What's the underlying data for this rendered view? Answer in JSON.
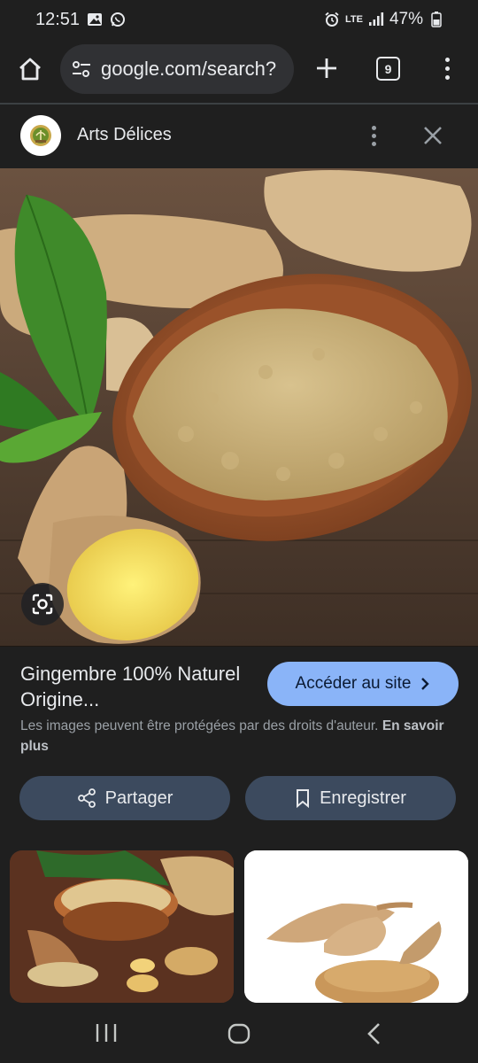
{
  "status_bar": {
    "time": "12:51",
    "network": "LTE",
    "battery": "47%",
    "icons": [
      "gallery-icon",
      "whatsapp-icon",
      "alarm-icon",
      "signal-icon",
      "battery-icon"
    ]
  },
  "browser": {
    "url": "google.com/search?",
    "tab_count": "9",
    "icons": [
      "home-icon",
      "tune-icon",
      "plus-icon",
      "more-vert-icon"
    ]
  },
  "site": {
    "name": "Arts Délices",
    "icons": [
      "site-logo-icon",
      "more-vert-icon",
      "close-icon"
    ]
  },
  "result": {
    "title": "Gingembre 100% Naturel Origine...",
    "visit_label": "Accéder au site",
    "copyright_text": "Les images peuvent être protégées par des droits d'auteur.",
    "learn_more": "En savoir plus",
    "share_label": "Partager",
    "save_label": "Enregistrer"
  },
  "colors": {
    "background": "#1f1f1f",
    "accent": "#8ab4f8",
    "action_button": "#3c4a5e",
    "text": "#e8eaed",
    "muted": "#9aa0a6"
  },
  "nav": {
    "icons": [
      "recents-icon",
      "home-icon",
      "back-icon"
    ]
  }
}
